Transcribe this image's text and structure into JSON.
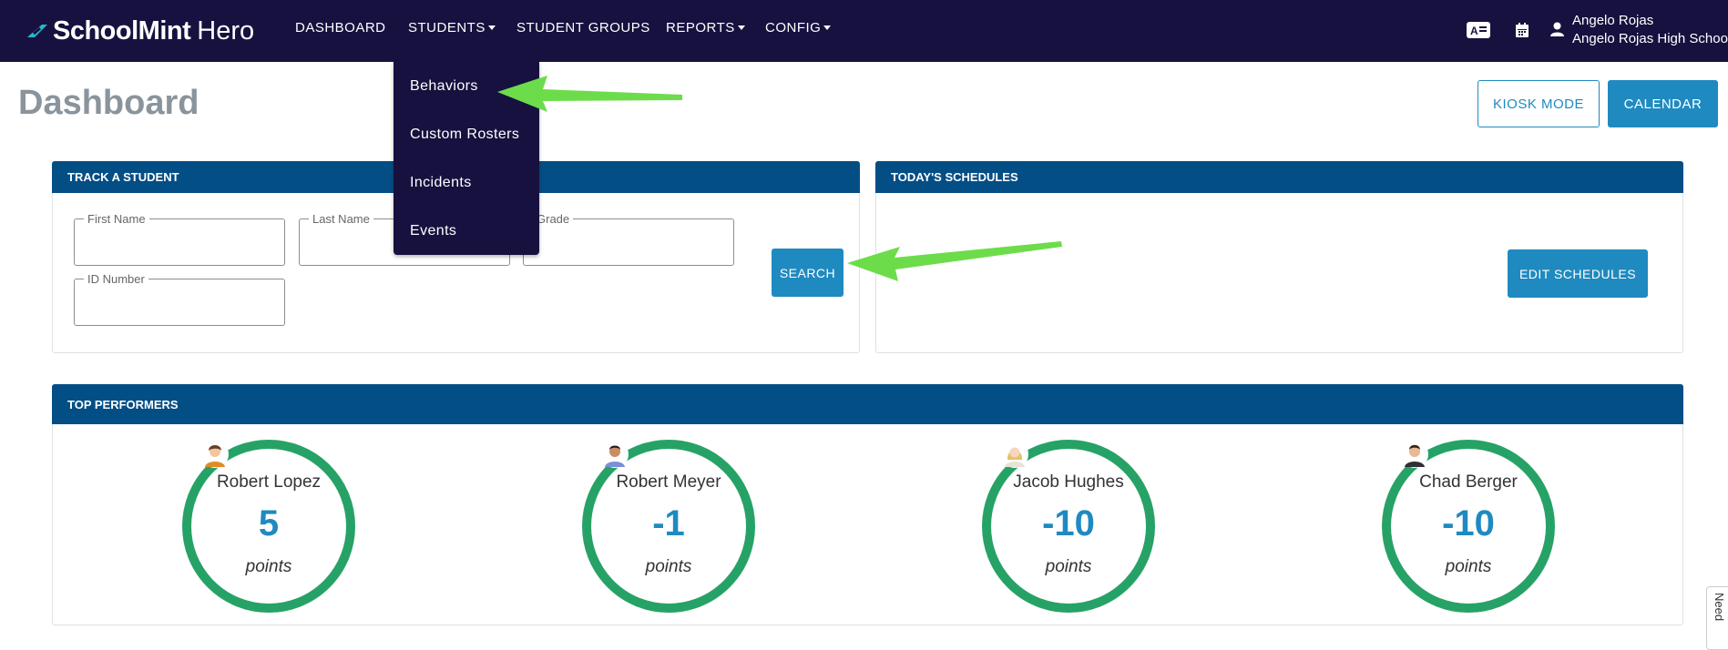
{
  "brand": {
    "name_bold": "SchoolMint",
    "name_light": "Hero"
  },
  "nav": {
    "dashboard": "DASHBOARD",
    "students": "STUDENTS",
    "student_groups": "STUDENT GROUPS",
    "reports": "REPORTS",
    "config": "CONFIG"
  },
  "user": {
    "name": "Angelo Rojas",
    "school": "Angelo Rojas High School"
  },
  "students_menu": [
    "Behaviors",
    "Custom Rosters",
    "Incidents",
    "Events"
  ],
  "page": {
    "title": "Dashboard",
    "kiosk_label": "KIOSK MODE",
    "calendar_label": "CALENDAR"
  },
  "track": {
    "header": "TRACK A STUDENT",
    "first_name_label": "First Name",
    "last_name_label": "Last Name",
    "grade_label": "Grade",
    "id_label": "ID Number",
    "search_label": "SEARCH"
  },
  "schedules": {
    "header": "TODAY'S SCHEDULES",
    "edit_label": "EDIT SCHEDULES"
  },
  "top_performers": {
    "header": "TOP PERFORMERS",
    "items": [
      {
        "name": "Robert Lopez",
        "score": "5",
        "unit": "points"
      },
      {
        "name": "Robert Meyer",
        "score": "-1",
        "unit": "points"
      },
      {
        "name": "Jacob Hughes",
        "score": "-10",
        "unit": "points"
      },
      {
        "name": "Chad Berger",
        "score": "-10",
        "unit": "points"
      }
    ]
  },
  "help_tab": {
    "label": "Need"
  },
  "colors": {
    "nav_bg": "#16113f",
    "panel_header": "#044e86",
    "accent": "#1f8ac0",
    "ring": "#27a266",
    "annotation_arrow": "#6ddc4b"
  }
}
